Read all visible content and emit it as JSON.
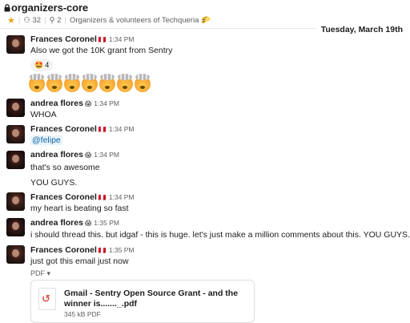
{
  "channel": {
    "name": "organizers-core",
    "member_count": "32",
    "pinned_count": "2",
    "topic": "Organizers & volunteers of Techqueria"
  },
  "date_divider": "Tuesday, March 19th",
  "messages": [
    {
      "author": "Frances Coronel",
      "badge": "🇵🇪",
      "time": "1:34 PM",
      "text": "Also we got the 10K grant from Sentry",
      "reaction_count": "4"
    },
    {
      "author": "andrea flores",
      "badge": "😱",
      "time": "1:34 PM",
      "text": "WHOA"
    },
    {
      "author": "Frances Coronel",
      "badge": "🇵🇪",
      "time": "1:34 PM",
      "text": "@felipe"
    },
    {
      "author": "andrea flores",
      "badge": "😱",
      "time": "1:34 PM",
      "text": "that's so awesome",
      "text2": "YOU GUYS."
    },
    {
      "author": "Frances Coronel",
      "badge": "🇵🇪",
      "time": "1:34 PM",
      "text": "my heart is beating so fast"
    },
    {
      "author": "andrea flores",
      "badge": "😱",
      "time": "1:35 PM",
      "text": "i should thread this. but idgaf - this is huge. let's just make a million comments about this. YOU GUYS."
    },
    {
      "author": "Frances Coronel",
      "badge": "🇵🇪",
      "time": "1:35 PM",
      "text": "just got this email just now"
    }
  ],
  "attachment": {
    "type_label": "PDF",
    "title": "Gmail - Sentry Open Source Grant - and the winner is......._.pdf",
    "meta": "345 kB PDF"
  }
}
